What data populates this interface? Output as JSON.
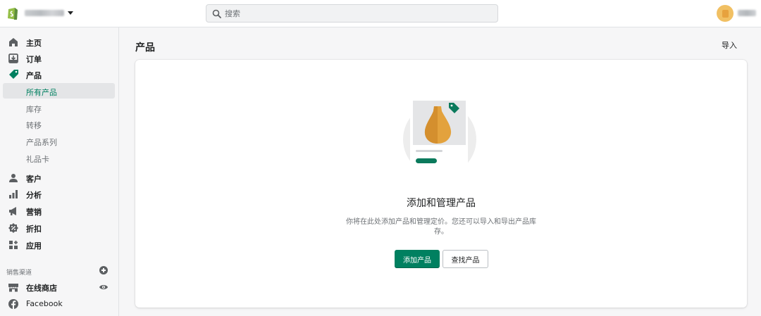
{
  "topbar": {
    "search_placeholder": "搜索"
  },
  "sidebar": {
    "items": [
      {
        "label": "主页",
        "icon": "home-icon"
      },
      {
        "label": "订单",
        "icon": "orders-icon"
      },
      {
        "label": "产品",
        "icon": "tag-icon"
      }
    ],
    "product_subitems": [
      "所有产品",
      "库存",
      "转移",
      "产品系列",
      "礼品卡"
    ],
    "items2": [
      {
        "label": "客户",
        "icon": "customer-icon"
      },
      {
        "label": "分析",
        "icon": "analytics-icon"
      },
      {
        "label": "营销",
        "icon": "megaphone-icon"
      },
      {
        "label": "折扣",
        "icon": "discount-icon"
      },
      {
        "label": "应用",
        "icon": "apps-icon"
      }
    ],
    "channels_title": "销售渠道",
    "channels": [
      {
        "label": "在线商店",
        "icon": "store-icon"
      },
      {
        "label": "Facebook",
        "icon": "facebook-icon"
      }
    ]
  },
  "main": {
    "title": "产品",
    "import_label": "导入",
    "empty_state": {
      "title": "添加和管理产品",
      "description": "你将在此处添加产品和管理定价。您还可以导入和导出产品库存。",
      "primary_label": "添加产品",
      "secondary_label": "查找产品"
    }
  },
  "colors": {
    "accent": "#008060",
    "tag": "#0b7a5c",
    "vase": "#e3a23d"
  }
}
